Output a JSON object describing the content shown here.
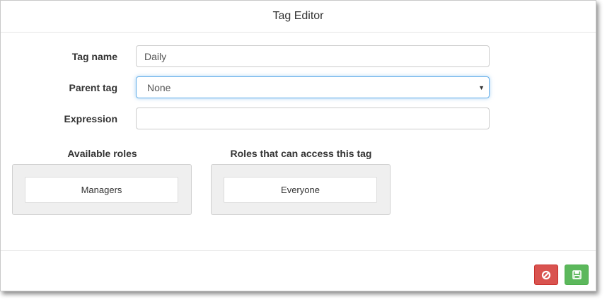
{
  "dialog": {
    "title": "Tag Editor"
  },
  "form": {
    "tag_name": {
      "label": "Tag name",
      "value": "Daily"
    },
    "parent_tag": {
      "label": "Parent tag",
      "selected": "None"
    },
    "expression": {
      "label": "Expression",
      "value": ""
    }
  },
  "roles": {
    "available": {
      "title": "Available roles",
      "items": [
        "Managers"
      ]
    },
    "access": {
      "title": "Roles that can access this tag",
      "items": [
        "Everyone"
      ]
    }
  },
  "footer": {
    "cancel_icon": "ban-icon",
    "save_icon": "floppy-disk-icon"
  },
  "colors": {
    "cancel": "#d9534f",
    "save": "#5cb85c",
    "focus": "#66afe9"
  }
}
